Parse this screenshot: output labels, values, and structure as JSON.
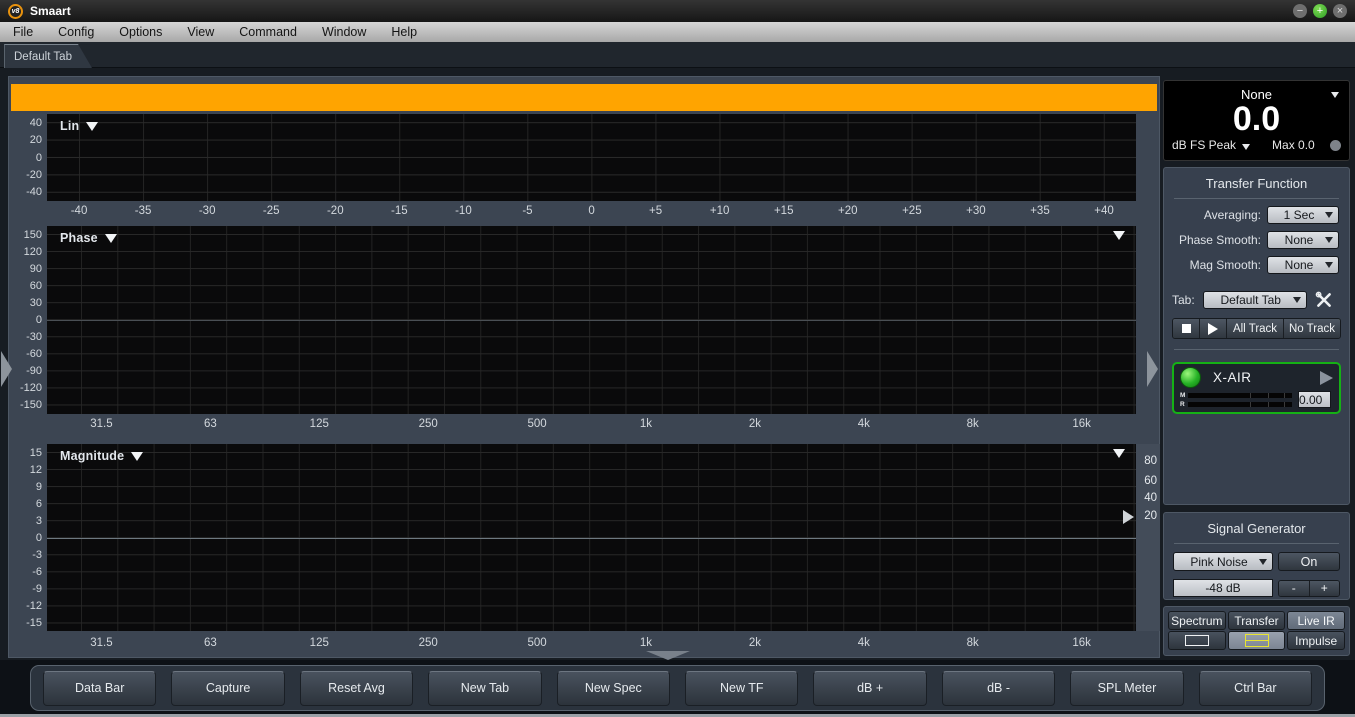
{
  "window": {
    "logo": "v8",
    "title": "Smaart",
    "controls": {
      "minimize": "−",
      "zoom": "+",
      "close": "×"
    }
  },
  "menu": {
    "items": [
      "File",
      "Config",
      "Options",
      "View",
      "Command",
      "Window",
      "Help"
    ]
  },
  "doc_tab": {
    "label": "Default Tab"
  },
  "colors": {
    "accent_orange": "#ffa400",
    "panel_slate": "#37404e",
    "plot_black": "#0a0a0b",
    "active_green": "#15b115",
    "select_light": "#c9cdd2",
    "mode_active": "#7d8795",
    "icon_yellow": "#e8e432"
  },
  "chart_data": [
    {
      "type": "line",
      "title": "Lin",
      "series": [],
      "x_ticks": [
        "-40",
        "-35",
        "-30",
        "-25",
        "-20",
        "-15",
        "-10",
        "-5",
        "0",
        "+5",
        "+10",
        "+15",
        "+20",
        "+25",
        "+30",
        "+35",
        "+40"
      ],
      "y_ticks": [
        "40",
        "20",
        "0",
        "-20",
        "-40"
      ],
      "xlim": [
        -42.5,
        42.5
      ],
      "ylim": [
        -50,
        50
      ],
      "grid": true,
      "note": "empty live impulse-response time-domain plot, no trace shown"
    },
    {
      "type": "line",
      "title": "Phase",
      "series": [],
      "x_ticks": [
        "31.5",
        "63",
        "125",
        "250",
        "500",
        "1k",
        "2k",
        "4k",
        "8k",
        "16k"
      ],
      "y_ticks": [
        "150",
        "120",
        "90",
        "60",
        "30",
        "0",
        "-30",
        "-60",
        "-90",
        "-120",
        "-150"
      ],
      "xscale": "log",
      "ylim": [
        -165,
        165
      ],
      "grid": true,
      "note": "empty transfer-function phase plot, no trace shown"
    },
    {
      "type": "line",
      "title": "Magnitude",
      "series": [],
      "x_ticks": [
        "31.5",
        "63",
        "125",
        "250",
        "500",
        "1k",
        "2k",
        "4k",
        "8k",
        "16k"
      ],
      "y_ticks": [
        "15",
        "12",
        "9",
        "6",
        "3",
        "0",
        "-3",
        "-6",
        "-9",
        "-12",
        "-15"
      ],
      "y2_ticks": [
        "80",
        "60",
        "40",
        "20"
      ],
      "xscale": "log",
      "ylim": [
        -16.5,
        16.5
      ],
      "grid": true,
      "note": "empty transfer-function magnitude plot, no trace shown"
    }
  ],
  "meter": {
    "source": "None",
    "value": "0.0",
    "unit": "dB FS Peak",
    "max_label": "Max 0.0"
  },
  "transfer_function": {
    "title": "Transfer Function",
    "averaging_label": "Averaging:",
    "averaging": "1 Sec",
    "phase_smooth_label": "Phase Smooth:",
    "phase_smooth": "None",
    "mag_smooth_label": "Mag Smooth:",
    "mag_smooth": "None",
    "tab_label": "Tab:",
    "tab": "Default Tab",
    "all_track": "All Track",
    "no_track": "No Track"
  },
  "signal_group": {
    "name": "X-AIR",
    "value": "0.00",
    "meter_left": "M",
    "meter_right": "R"
  },
  "signal_generator": {
    "title": "Signal Generator",
    "type": "Pink Noise",
    "on_label": "On",
    "level": "-48 dB",
    "dec": "-",
    "inc": "+"
  },
  "mode_tabs": {
    "spectrum": "Spectrum",
    "transfer": "Transfer",
    "live_ir": "Live IR",
    "active": "Live IR",
    "impulse": "Impulse"
  },
  "bottom_bar": {
    "buttons": [
      "Data Bar",
      "Capture",
      "Reset Avg",
      "New Tab",
      "New Spec",
      "New TF",
      "dB +",
      "dB -",
      "SPL Meter",
      "Ctrl Bar"
    ]
  }
}
